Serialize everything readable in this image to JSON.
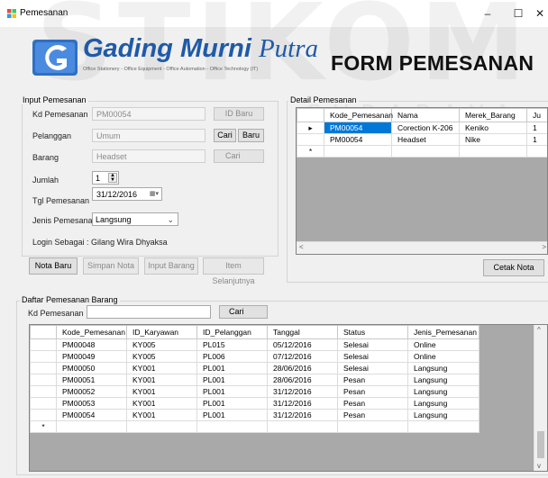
{
  "window": {
    "title": "Pemesanan",
    "minimize": "–",
    "maximize": "☐",
    "close": "✕"
  },
  "watermark": {
    "big": "STIKOM",
    "sub": "S U R A B A Y A"
  },
  "brand": {
    "name_main": "Gading Murni ",
    "name_script": "Putra",
    "tagline": "Office Stationery - Office Equipment - Office Automation - Office Technology (IT)"
  },
  "form_title": "FORM PEMESANAN",
  "input": {
    "group_label": "Input Pemesanan",
    "kd_label": "Kd Pemesanan",
    "kd_value": "PM00054",
    "id_baru": "ID Baru",
    "pelanggan_label": "Pelanggan",
    "pelanggan_value": "Umum",
    "cari": "Cari",
    "baru": "Baru",
    "barang_label": "Barang",
    "barang_value": "Headset",
    "cari_barang": "Cari",
    "jumlah_label": "Jumlah",
    "jumlah_value": "1",
    "tgl_label": "Tgl Pemesanan",
    "tgl_value": "31/12/2016",
    "jenis_label": "Jenis Pemesanan",
    "jenis_value": "Langsung",
    "login": "Login Sebagai : Gilang Wira Dhyaksa",
    "btn_nota_baru": "Nota Baru",
    "btn_simpan": "Simpan Nota",
    "btn_input": "Input Barang",
    "btn_item": "Item Selanjutnya"
  },
  "detail": {
    "group_label": "Detail Pemesanan",
    "columns": [
      "Kode_Pemesanan",
      "Nama",
      "Merek_Barang",
      "Ju"
    ],
    "rows": [
      [
        "PM00054",
        "Corection K-206",
        "Keniko",
        "1"
      ],
      [
        "PM00054",
        "Headset",
        "Nike",
        "1"
      ]
    ],
    "row_marker": "▸",
    "new_marker": "*",
    "cetak_nota": "Cetak Nota"
  },
  "daftar": {
    "group_label": "Daftar Pemesanan Barang",
    "kd_label": "Kd Pemesanan",
    "kd_value": "",
    "cari": "Cari",
    "columns": [
      "Kode_Pemesanan",
      "ID_Karyawan",
      "ID_Pelanggan",
      "Tanggal",
      "Status",
      "Jenis_Pemesanan"
    ],
    "rows": [
      [
        "PM00048",
        "KY005",
        "PL015",
        "05/12/2016",
        "Selesai",
        "Online"
      ],
      [
        "PM00049",
        "KY005",
        "PL006",
        "07/12/2016",
        "Selesai",
        "Online"
      ],
      [
        "PM00050",
        "KY001",
        "PL001",
        "28/06/2016",
        "Selesai",
        "Langsung"
      ],
      [
        "PM00051",
        "KY001",
        "PL001",
        "28/06/2016",
        "Pesan",
        "Langsung"
      ],
      [
        "PM00052",
        "KY001",
        "PL001",
        "31/12/2016",
        "Pesan",
        "Langsung"
      ],
      [
        "PM00053",
        "KY001",
        "PL001",
        "31/12/2016",
        "Pesan",
        "Langsung"
      ],
      [
        "PM00054",
        "KY001",
        "PL001",
        "31/12/2016",
        "Pesan",
        "Langsung"
      ]
    ],
    "new_marker": "*"
  },
  "colors": {
    "brand_blue": "#1f5aa8",
    "selection": "#0078d7"
  }
}
